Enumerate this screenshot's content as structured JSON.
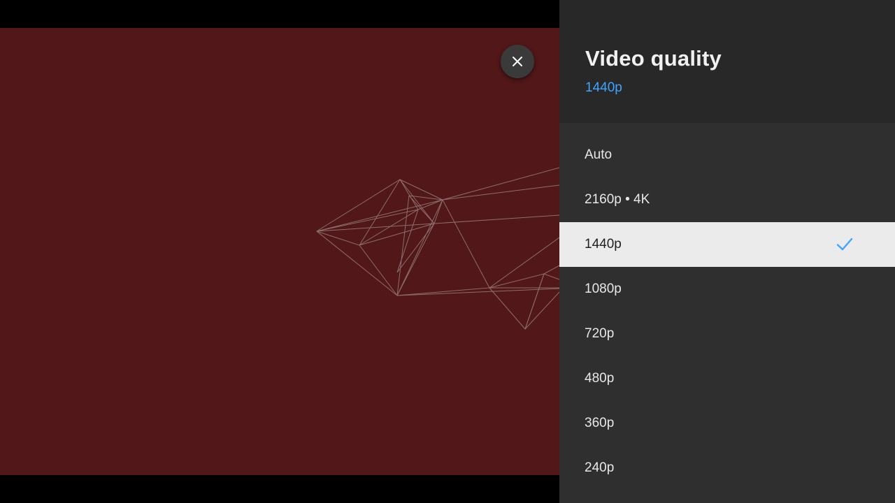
{
  "panel": {
    "title": "Video quality",
    "current_value": "1440p",
    "options": [
      {
        "label": "Auto",
        "selected": false
      },
      {
        "label": "2160p • 4K",
        "selected": false
      },
      {
        "label": "1440p",
        "selected": true
      },
      {
        "label": "1080p",
        "selected": false
      },
      {
        "label": "720p",
        "selected": false
      },
      {
        "label": "480p",
        "selected": false
      },
      {
        "label": "360p",
        "selected": false
      },
      {
        "label": "240p",
        "selected": false
      }
    ]
  },
  "player": {
    "close_icon": "close-icon",
    "background_color": "#521718"
  },
  "colors": {
    "accent": "#3ea6ff",
    "panel_bg": "#2f2f2f",
    "header_bg": "#282828",
    "selected_bg": "#ebebeb"
  }
}
